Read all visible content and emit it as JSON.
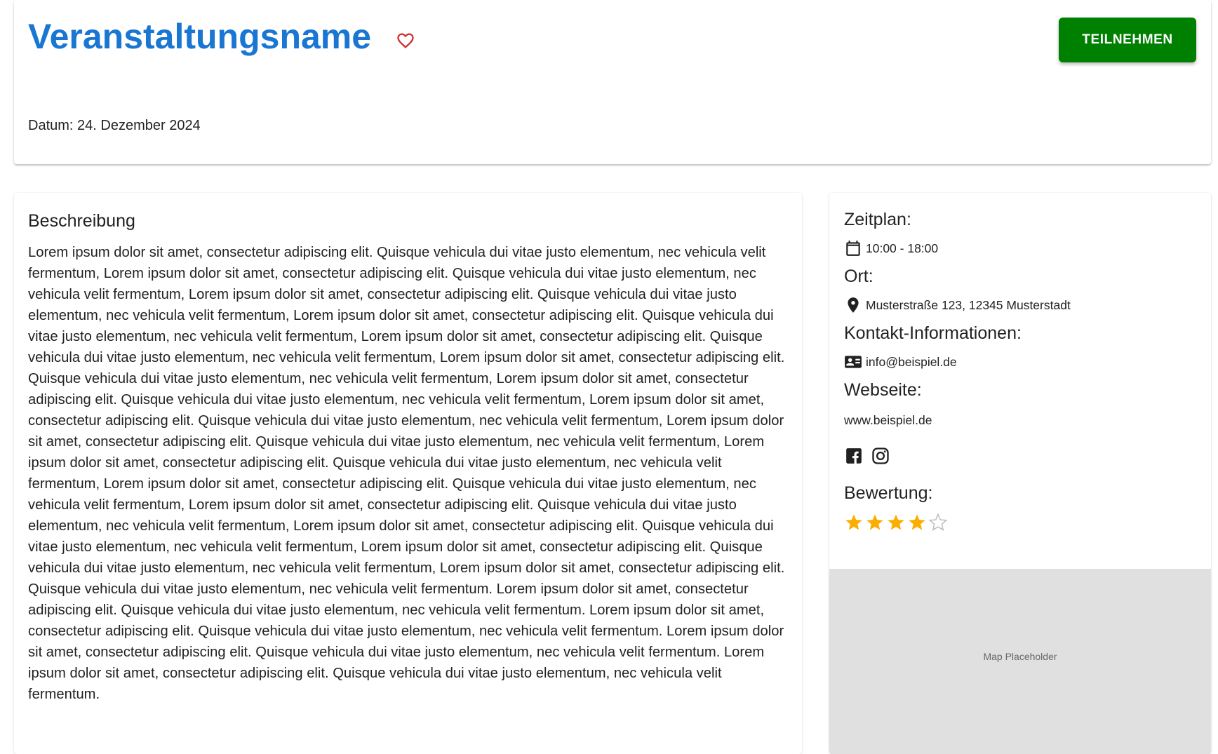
{
  "header": {
    "title": "Veranstaltungsname",
    "join_label": "TEILNEHMEN",
    "date_text": "Datum: 24. Dezember 2024",
    "favorite_icon": "heart-outline-icon",
    "accent_color": "#1976d2",
    "join_color": "#008000",
    "favorite_color": "#d32f2f"
  },
  "description": {
    "heading": "Beschreibung",
    "text": "Lorem ipsum dolor sit amet, consectetur adipiscing elit. Quisque vehicula dui vitae justo elementum, nec vehicula velit fermentum, Lorem ipsum dolor sit amet, consectetur adipiscing elit. Quisque vehicula dui vitae justo elementum, nec vehicula velit fermentum, Lorem ipsum dolor sit amet, consectetur adipiscing elit. Quisque vehicula dui vitae justo elementum, nec vehicula velit fermentum, Lorem ipsum dolor sit amet, consectetur adipiscing elit. Quisque vehicula dui vitae justo elementum, nec vehicula velit fermentum, Lorem ipsum dolor sit amet, consectetur adipiscing elit. Quisque vehicula dui vitae justo elementum, nec vehicula velit fermentum, Lorem ipsum dolor sit amet, consectetur adipiscing elit. Quisque vehicula dui vitae justo elementum, nec vehicula velit fermentum, Lorem ipsum dolor sit amet, consectetur adipiscing elit. Quisque vehicula dui vitae justo elementum, nec vehicula velit fermentum, Lorem ipsum dolor sit amet, consectetur adipiscing elit. Quisque vehicula dui vitae justo elementum, nec vehicula velit fermentum, Lorem ipsum dolor sit amet, consectetur adipiscing elit. Quisque vehicula dui vitae justo elementum, nec vehicula velit fermentum, Lorem ipsum dolor sit amet, consectetur adipiscing elit. Quisque vehicula dui vitae justo elementum, nec vehicula velit fermentum, Lorem ipsum dolor sit amet, consectetur adipiscing elit. Quisque vehicula dui vitae justo elementum, nec vehicula velit fermentum, Lorem ipsum dolor sit amet, consectetur adipiscing elit. Quisque vehicula dui vitae justo elementum, nec vehicula velit fermentum, Lorem ipsum dolor sit amet, consectetur adipiscing elit. Quisque vehicula dui vitae justo elementum, nec vehicula velit fermentum, Lorem ipsum dolor sit amet, consectetur adipiscing elit. Quisque vehicula dui vitae justo elementum, nec vehicula velit fermentum, Lorem ipsum dolor sit amet, consectetur adipiscing elit. Quisque vehicula dui vitae justo elementum, nec vehicula velit fermentum. Lorem ipsum dolor sit amet, consectetur adipiscing elit. Quisque vehicula dui vitae justo elementum, nec vehicula velit fermentum. Lorem ipsum dolor sit amet, consectetur adipiscing elit. Quisque vehicula dui vitae justo elementum, nec vehicula velit fermentum. Lorem ipsum dolor sit amet, consectetur adipiscing elit. Quisque vehicula dui vitae justo elementum, nec vehicula velit fermentum. Lorem ipsum dolor sit amet, consectetur adipiscing elit. Quisque vehicula dui vitae justo elementum, nec vehicula velit fermentum."
  },
  "info": {
    "schedule_heading": "Zeitplan:",
    "schedule_value": "10:00 - 18:00",
    "schedule_icon": "calendar-icon",
    "location_heading": "Ort:",
    "location_value": "Musterstraße 123, 12345 Musterstadt",
    "location_icon": "map-pin-icon",
    "contact_heading": "Kontakt-Informationen:",
    "contact_value": "info@beispiel.de",
    "contact_icon": "contact-card-icon",
    "website_heading": "Webseite:",
    "website_value": "www.beispiel.de",
    "social_icons": [
      "facebook-icon",
      "instagram-icon"
    ],
    "rating_heading": "Bewertung:",
    "rating": 4,
    "rating_max": 5,
    "star_color": "#faaf00"
  },
  "map": {
    "label": "Map Placeholder"
  }
}
